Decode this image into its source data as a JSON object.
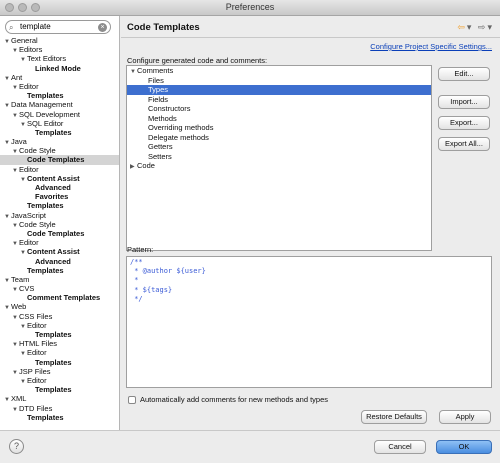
{
  "window": {
    "title": "Preferences"
  },
  "search": {
    "value": "template"
  },
  "tree": [
    {
      "label": "General",
      "indent": 0,
      "arrow": "▼",
      "bold": false,
      "sel": false
    },
    {
      "label": "Editors",
      "indent": 1,
      "arrow": "▼",
      "bold": false,
      "sel": false
    },
    {
      "label": "Text Editors",
      "indent": 2,
      "arrow": "▼",
      "bold": false,
      "sel": false
    },
    {
      "label": "Linked Mode",
      "indent": 3,
      "arrow": "",
      "bold": true,
      "sel": false
    },
    {
      "label": "Ant",
      "indent": 0,
      "arrow": "▼",
      "bold": false,
      "sel": false
    },
    {
      "label": "Editor",
      "indent": 1,
      "arrow": "▼",
      "bold": false,
      "sel": false
    },
    {
      "label": "Templates",
      "indent": 2,
      "arrow": "",
      "bold": true,
      "sel": false
    },
    {
      "label": "Data Management",
      "indent": 0,
      "arrow": "▼",
      "bold": false,
      "sel": false
    },
    {
      "label": "SQL Development",
      "indent": 1,
      "arrow": "▼",
      "bold": false,
      "sel": false
    },
    {
      "label": "SQL Editor",
      "indent": 2,
      "arrow": "▼",
      "bold": false,
      "sel": false
    },
    {
      "label": "Templates",
      "indent": 3,
      "arrow": "",
      "bold": true,
      "sel": false
    },
    {
      "label": "Java",
      "indent": 0,
      "arrow": "▼",
      "bold": false,
      "sel": false
    },
    {
      "label": "Code Style",
      "indent": 1,
      "arrow": "▼",
      "bold": false,
      "sel": false
    },
    {
      "label": "Code Templates",
      "indent": 2,
      "arrow": "",
      "bold": true,
      "sel": true
    },
    {
      "label": "Editor",
      "indent": 1,
      "arrow": "▼",
      "bold": false,
      "sel": false
    },
    {
      "label": "Content Assist",
      "indent": 2,
      "arrow": "▼",
      "bold": true,
      "sel": false
    },
    {
      "label": "Advanced",
      "indent": 3,
      "arrow": "",
      "bold": true,
      "sel": false
    },
    {
      "label": "Favorites",
      "indent": 3,
      "arrow": "",
      "bold": true,
      "sel": false
    },
    {
      "label": "Templates",
      "indent": 2,
      "arrow": "",
      "bold": true,
      "sel": false
    },
    {
      "label": "JavaScript",
      "indent": 0,
      "arrow": "▼",
      "bold": false,
      "sel": false
    },
    {
      "label": "Code Style",
      "indent": 1,
      "arrow": "▼",
      "bold": false,
      "sel": false
    },
    {
      "label": "Code Templates",
      "indent": 2,
      "arrow": "",
      "bold": true,
      "sel": false
    },
    {
      "label": "Editor",
      "indent": 1,
      "arrow": "▼",
      "bold": false,
      "sel": false
    },
    {
      "label": "Content Assist",
      "indent": 2,
      "arrow": "▼",
      "bold": true,
      "sel": false
    },
    {
      "label": "Advanced",
      "indent": 3,
      "arrow": "",
      "bold": true,
      "sel": false
    },
    {
      "label": "Templates",
      "indent": 2,
      "arrow": "",
      "bold": true,
      "sel": false
    },
    {
      "label": "Team",
      "indent": 0,
      "arrow": "▼",
      "bold": false,
      "sel": false
    },
    {
      "label": "CVS",
      "indent": 1,
      "arrow": "▼",
      "bold": false,
      "sel": false
    },
    {
      "label": "Comment Templates",
      "indent": 2,
      "arrow": "",
      "bold": true,
      "sel": false
    },
    {
      "label": "Web",
      "indent": 0,
      "arrow": "▼",
      "bold": false,
      "sel": false
    },
    {
      "label": "CSS Files",
      "indent": 1,
      "arrow": "▼",
      "bold": false,
      "sel": false
    },
    {
      "label": "Editor",
      "indent": 2,
      "arrow": "▼",
      "bold": false,
      "sel": false
    },
    {
      "label": "Templates",
      "indent": 3,
      "arrow": "",
      "bold": true,
      "sel": false
    },
    {
      "label": "HTML Files",
      "indent": 1,
      "arrow": "▼",
      "bold": false,
      "sel": false
    },
    {
      "label": "Editor",
      "indent": 2,
      "arrow": "▼",
      "bold": false,
      "sel": false
    },
    {
      "label": "Templates",
      "indent": 3,
      "arrow": "",
      "bold": true,
      "sel": false
    },
    {
      "label": "JSP Files",
      "indent": 1,
      "arrow": "▼",
      "bold": false,
      "sel": false
    },
    {
      "label": "Editor",
      "indent": 2,
      "arrow": "▼",
      "bold": false,
      "sel": false
    },
    {
      "label": "Templates",
      "indent": 3,
      "arrow": "",
      "bold": true,
      "sel": false
    },
    {
      "label": "XML",
      "indent": 0,
      "arrow": "▼",
      "bold": false,
      "sel": false
    },
    {
      "label": "DTD Files",
      "indent": 1,
      "arrow": "▼",
      "bold": false,
      "sel": false
    },
    {
      "label": "Templates",
      "indent": 2,
      "arrow": "",
      "bold": true,
      "sel": false
    }
  ],
  "header": {
    "title": "Code Templates"
  },
  "link_label": "Configure Project Specific Settings...",
  "configure_label": "Configure generated code and comments:",
  "templates": [
    {
      "label": "Comments",
      "indent": 0,
      "arrow": "▼",
      "sel": false
    },
    {
      "label": "Files",
      "indent": 1,
      "arrow": "",
      "sel": false
    },
    {
      "label": "Types",
      "indent": 1,
      "arrow": "",
      "sel": true
    },
    {
      "label": "Fields",
      "indent": 1,
      "arrow": "",
      "sel": false
    },
    {
      "label": "Constructors",
      "indent": 1,
      "arrow": "",
      "sel": false
    },
    {
      "label": "Methods",
      "indent": 1,
      "arrow": "",
      "sel": false
    },
    {
      "label": "Overriding methods",
      "indent": 1,
      "arrow": "",
      "sel": false
    },
    {
      "label": "Delegate methods",
      "indent": 1,
      "arrow": "",
      "sel": false
    },
    {
      "label": "Getters",
      "indent": 1,
      "arrow": "",
      "sel": false
    },
    {
      "label": "Setters",
      "indent": 1,
      "arrow": "",
      "sel": false
    },
    {
      "label": "Code",
      "indent": 0,
      "arrow": "▶",
      "sel": false
    }
  ],
  "buttons": {
    "edit": "Edit...",
    "import": "Import...",
    "export": "Export...",
    "export_all": "Export All..."
  },
  "pattern_label": "Pattern:",
  "pattern_lines": [
    "/**",
    " * @author ${user}",
    " *",
    " * ${tags}",
    " */"
  ],
  "auto_comments_label": "Automatically add comments for new methods and types",
  "restore_label": "Restore Defaults",
  "apply_label": "Apply",
  "cancel_label": "Cancel",
  "ok_label": "OK"
}
